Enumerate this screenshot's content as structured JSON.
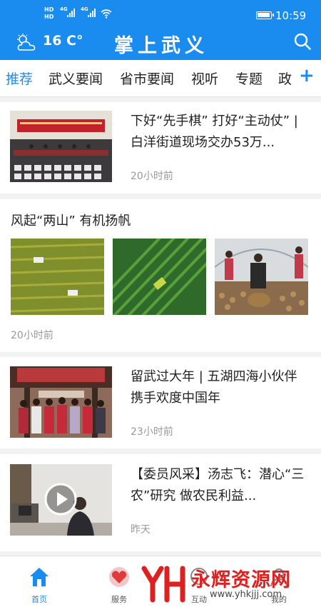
{
  "status_bar": {
    "sim1": "HD",
    "sim2": "HD",
    "network1": "4G",
    "network2": "4G",
    "time": "10:59"
  },
  "app_bar": {
    "weather_icon": "cloud-sun-icon",
    "temperature": "16 C°",
    "title": "掌上武义",
    "search_icon": "search-icon"
  },
  "tabs": [
    {
      "label": "推荐",
      "active": true
    },
    {
      "label": "武义要闻"
    },
    {
      "label": "省市要闻"
    },
    {
      "label": "视听"
    },
    {
      "label": "专题"
    },
    {
      "label": "政"
    }
  ],
  "tabs_add": "+",
  "feed": {
    "items": [
      {
        "title": "下好“先手棋” 打好“主动仗” | 白洋街道现场交办53万...",
        "time": "20小时前"
      },
      {
        "title": "风起“两山” 有机扬帆",
        "time": "20小时前"
      },
      {
        "title": "留武过大年 | 五湖四海小伙伴 携手欢度中国年",
        "time": "23小时前"
      },
      {
        "title": "【委员风采】汤志飞：潜心“三农”研究  做农民利益...",
        "time": "昨天"
      }
    ]
  },
  "bottom_nav": [
    {
      "label": "首页",
      "icon": "home-icon",
      "active": true
    },
    {
      "label": "服务",
      "icon": "heart-icon"
    },
    {
      "label": "互动",
      "icon": "chat-icon"
    },
    {
      "label": "我的",
      "icon": "user-icon"
    }
  ],
  "watermark": {
    "text": "永辉资源网",
    "url": "www.yhkjjj.com"
  },
  "colors": {
    "primary": "#1a8cf0",
    "watermark_red": "#e02020"
  }
}
